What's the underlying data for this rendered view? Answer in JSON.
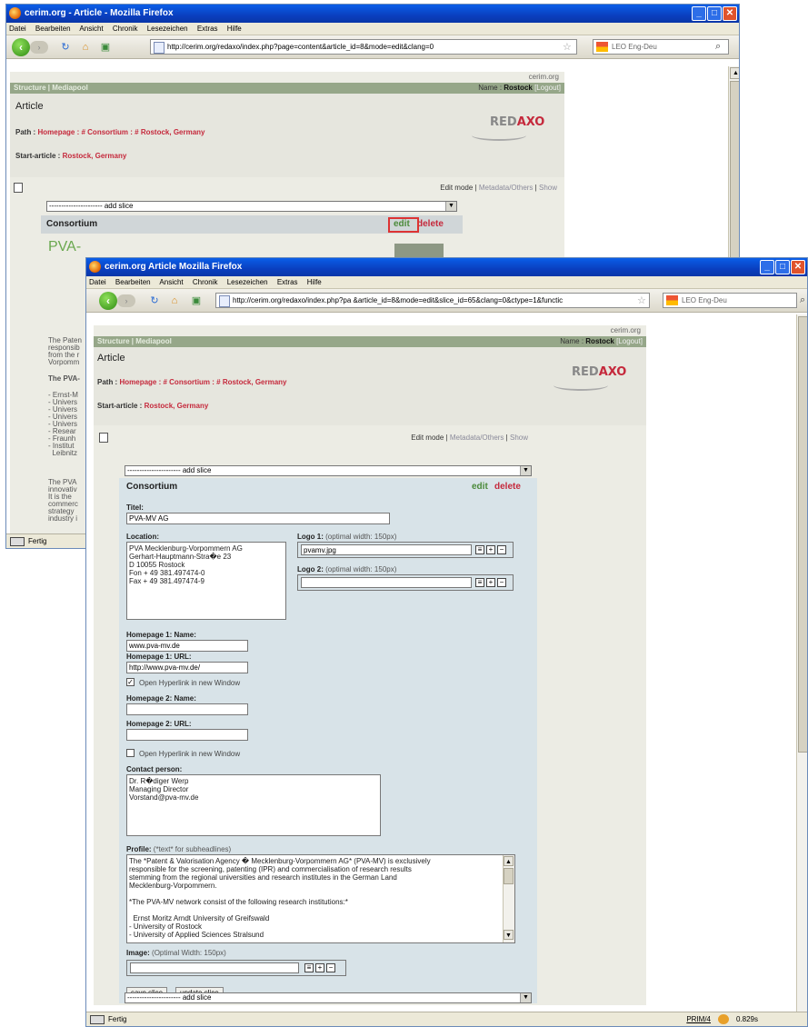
{
  "back_window": {
    "title": "cerim.org - Article - Mozilla Firefox",
    "menu": [
      "Datei",
      "Bearbeiten",
      "Ansicht",
      "Chronik",
      "Lesezeichen",
      "Extras",
      "Hilfe"
    ],
    "url": "http://cerim.org/redaxo/index.php?page=content&article_id=8&mode=edit&clang=0",
    "search_placeholder": "LEO Eng-Deu",
    "status": "Fertig",
    "site_name": "cerim.org",
    "nav_left": "Structure | Mediapool",
    "nav_right_name": "Name :",
    "nav_right_user": "Rostock",
    "nav_right_logout": "[Logout]",
    "heading": "Article",
    "path_label": "Path :",
    "path_links": "Homepage : # Consortium : # Rostock, Germany",
    "start_label": "Start-article :",
    "start_link": "Rostock, Germany",
    "logo_a": "RED",
    "logo_b": "AXO",
    "mode_edit": "Edit mode",
    "mode_sep1": "|",
    "mode_meta": "Metadata/Others",
    "mode_sep2": "|",
    "mode_show": "Show",
    "add_slice": "---------------------- add slice",
    "slice_title": "Consortium",
    "edit": "edit",
    "delete": "delete",
    "partial_heading": "PVA-",
    "partial_text_1": "The Paten\nresponsib\nfrom the r\nVorpomm",
    "partial_text_2": "The PVA-",
    "partial_text_3": "- Ernst-M\n- Univers\n- Univers\n- Univers\n- Univers\n- Resear\n- Fraunh\n- Institut\n  Leibnitz",
    "partial_text_4": "The PVA\ninnovativ\nIt is the\ncommerc\nstrategy\nindustry i"
  },
  "front_window": {
    "title": "cerim.org  Article  Mozilla Firefox",
    "menu": [
      "Datei",
      "Bearbeiten",
      "Ansicht",
      "Chronik",
      "Lesezeichen",
      "Extras",
      "Hilfe"
    ],
    "url": "http://cerim.org/redaxo/index.php?pa          &article_id=8&mode=edit&slice_id=65&clang=0&ctype=1&functic",
    "search_placeholder": "LEO Eng-Deu",
    "status": "Fertig",
    "status_right": "PRIM/4",
    "status_time": "0.829s",
    "site_name": "cerim.org",
    "nav_left": "Structure | Mediapool",
    "nav_right_name": "Name :",
    "nav_right_user": "Rostock",
    "nav_right_logout": "[Logout]",
    "heading": "Article",
    "path_label": "Path :",
    "path_links": "Homepage : # Consortium : # Rostock, Germany",
    "start_label": "Start-article :",
    "start_link": "Rostock, Germany",
    "logo_a": "RED",
    "logo_b": "AXO",
    "mode_edit": "Edit mode",
    "mode_sep1": "|",
    "mode_meta": "Metadata/Others",
    "mode_sep2": "|",
    "mode_show": "Show",
    "add_slice": "---------------------- add slice",
    "slice_title": "Consortium",
    "edit": "edit",
    "delete": "delete",
    "form": {
      "title_label": "Titel:",
      "title_value": "PVA-MV AG",
      "location_label": "Location:",
      "location_value": "PVA Mecklenburg-Vorpommern AG\nGerhart-Hauptmann-Stra�e 23\nD 10055 Rostock\nFon + 49 381.497474-0\nFax + 49 381.497474-9",
      "logo1_label": "Logo 1:",
      "logo1_hint": "(optimal width: 150px)",
      "logo1_value": "pvamv.jpg",
      "logo2_label": "Logo 2:",
      "logo2_hint": "(optimal width: 150px)",
      "logo2_value": "",
      "hp1_name_label": "Homepage 1: Name:",
      "hp1_name_value": "www.pva-mv.de",
      "hp1_url_label": "Homepage 1: URL:",
      "hp1_url_value": "http://www.pva-mv.de/",
      "hp1_newwin_label": "Open Hyperlink in new Window",
      "hp2_name_label": "Homepage 2: Name:",
      "hp2_url_label": "Homepage 2: URL:",
      "hp2_newwin_label": "Open Hyperlink in new Window",
      "contact_label": "Contact person:",
      "contact_value": "Dr. R�diger Werp\nManaging Director\nVorstand@pva-mv.de",
      "profile_label": "Profile:",
      "profile_hint": "(*text* for subheadlines)",
      "profile_value": "The *Patent & Valorisation Agency � Mecklenburg-Vorpommern AG* (PVA-MV) is exclusively\nresponsible for the screening, patenting (IPR) and commercialisation of research results\nstemming from the regional universities and research institutes in the German Land\nMecklenburg-Vorpommern.\n\n*The PVA-MV network consist of the following research institutions:*\n\n  Ernst Moritz Arndt University of Greifswald\n- University of Rostock\n- University of Applied Sciences Stralsund",
      "image_label": "Image:",
      "image_hint": "(Optimal Width: 150px)",
      "save_button": "save slice",
      "update_button": "update slice",
      "add_slice_bottom": "---------------------- add slice"
    }
  },
  "colors": {
    "accent_red": "#c5293c",
    "accent_green": "#4b8a3a",
    "nav_green": "#96a789",
    "form_bg": "#d8e3e8"
  }
}
